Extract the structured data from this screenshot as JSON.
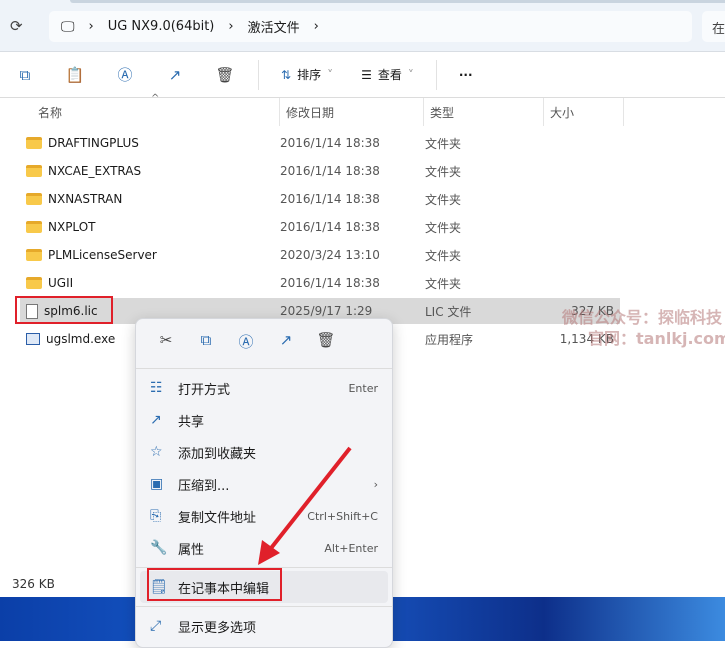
{
  "address": {
    "crumbs": [
      "UG NX9.0(64bit)",
      "激活文件"
    ],
    "search_partial": "在"
  },
  "toolbar": {
    "sort": "排序",
    "view": "查看",
    "more": "···"
  },
  "columns": [
    "名称",
    "修改日期",
    "类型",
    "大小"
  ],
  "files": [
    {
      "name": "DRAFTINGPLUS",
      "date": "2016/1/14 18:38",
      "type": "文件夹",
      "size": "",
      "kind": "folder"
    },
    {
      "name": "NXCAE_EXTRAS",
      "date": "2016/1/14 18:38",
      "type": "文件夹",
      "size": "",
      "kind": "folder"
    },
    {
      "name": "NXNASTRAN",
      "date": "2016/1/14 18:38",
      "type": "文件夹",
      "size": "",
      "kind": "folder"
    },
    {
      "name": "NXPLOT",
      "date": "2016/1/14 18:38",
      "type": "文件夹",
      "size": "",
      "kind": "folder"
    },
    {
      "name": "PLMLicenseServer",
      "date": "2020/3/24 13:10",
      "type": "文件夹",
      "size": "",
      "kind": "folder"
    },
    {
      "name": "UGII",
      "date": "2016/1/14 18:38",
      "type": "文件夹",
      "size": "",
      "kind": "folder"
    },
    {
      "name": "splm6.lic",
      "date": "2025/9/17 1:29",
      "type": "LIC 文件",
      "size": "327 KB",
      "kind": "file"
    },
    {
      "name": "ugslmd.exe",
      "date": "",
      "type": "应用程序",
      "size": "1,134 KB",
      "kind": "exe"
    }
  ],
  "status": {
    "selected_size": "326 KB"
  },
  "menu": {
    "items": [
      {
        "label": "打开方式",
        "shortcut": "Enter",
        "icon": "open-with-icon"
      },
      {
        "label": "共享",
        "shortcut": "",
        "icon": "share-icon"
      },
      {
        "label": "添加到收藏夹",
        "shortcut": "",
        "icon": "star-icon"
      },
      {
        "label": "压缩到...",
        "shortcut": "›",
        "icon": "zip-icon"
      },
      {
        "label": "复制文件地址",
        "shortcut": "Ctrl+Shift+C",
        "icon": "copy-path-icon"
      },
      {
        "label": "属性",
        "shortcut": "Alt+Enter",
        "icon": "wrench-icon"
      }
    ],
    "notepad": "在记事本中编辑",
    "more": "显示更多选项"
  },
  "watermark": {
    "line1": "微信公众号：探临科技",
    "line2": "官网：tanlkj.com"
  }
}
